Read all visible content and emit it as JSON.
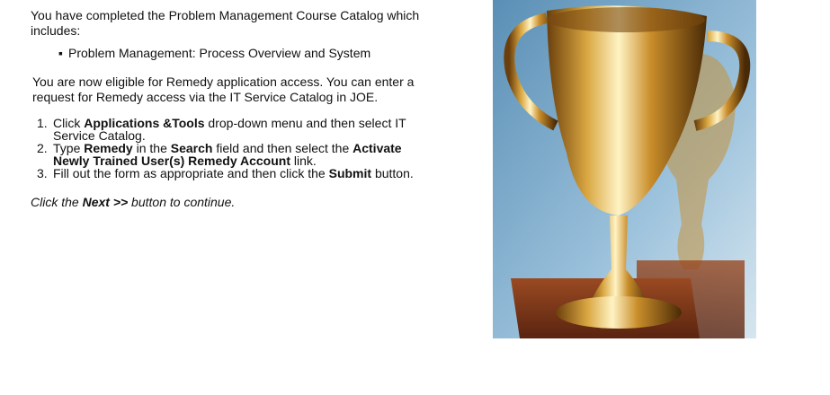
{
  "intro": "You have completed the Problem Management Course Catalog which includes:",
  "courses": [
    "Problem Management: Process Overview and System"
  ],
  "eligible": "You are now eligible for Remedy application access. You can enter a request for Remedy access via the IT Service Catalog in JOE.",
  "steps": [
    {
      "n": "1.",
      "a": "Click ",
      "b1": "Applications &Tools",
      "c": " drop-down menu and then select IT Service Catalog.",
      "b2": "",
      "d": "",
      "b3": "",
      "e": ""
    },
    {
      "n": "2.",
      "a": "Type ",
      "b1": "Remedy",
      "c": " in the ",
      "b2": "Search",
      "d": " field and then select the ",
      "b3": "Activate Newly Trained User(s) Remedy Account",
      "e": " link."
    },
    {
      "n": "3.",
      "a": "Fill out the form as appropriate and then click the ",
      "b1": "Submit",
      "c": " button.",
      "b2": "",
      "d": "",
      "b3": "",
      "e": ""
    }
  ],
  "continue": {
    "before": "Click the ",
    "bold": "Next >>",
    "after": " button to continue."
  }
}
